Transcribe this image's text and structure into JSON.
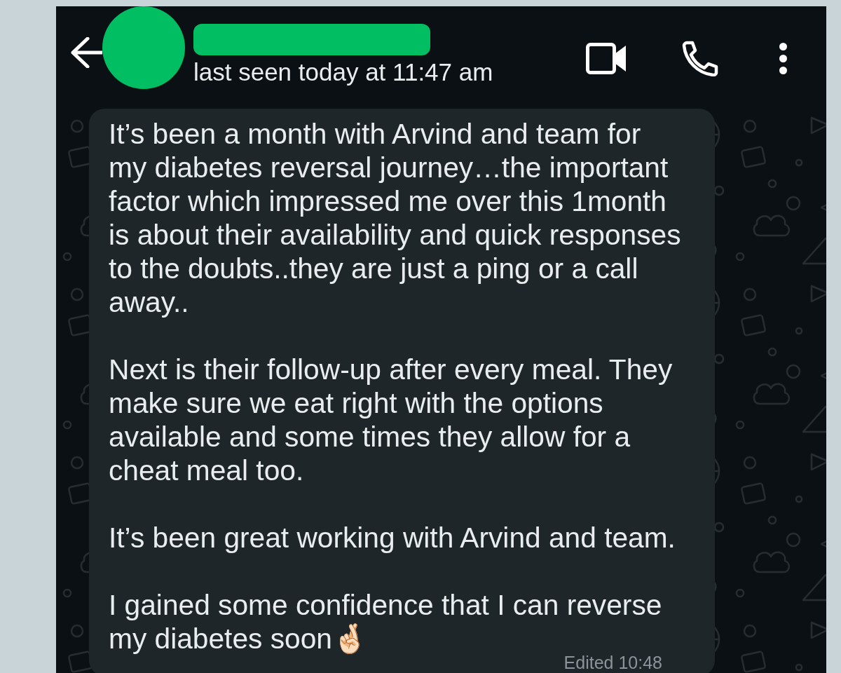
{
  "header": {
    "status": "last seen today at 11:47 am"
  },
  "message": {
    "paragraphs": [
      "It’s been a month with Arvind and team for my diabetes reversal journey…the important factor which impressed me over this 1month is about their availability and quick responses to the doubts..they are just a ping or a call away..",
      "Next is their follow-up after every meal. They make sure we eat right with the options available and some times they allow for a cheat meal too.",
      "It’s been great working with Arvind and team.",
      "I gained some confidence that I can reverse my diabetes soon🤞🏻"
    ],
    "edited_time": "Edited 10:48"
  }
}
